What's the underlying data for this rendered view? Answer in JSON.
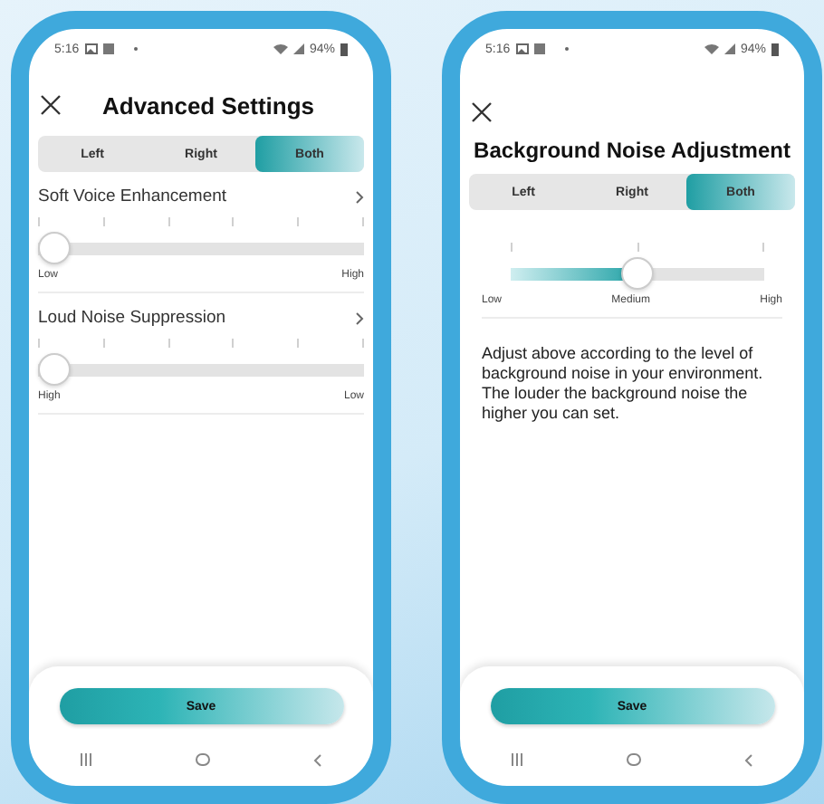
{
  "screens": [
    {
      "kind": "list",
      "status": {
        "time": "5:16",
        "battery": "94%"
      },
      "title": "Advanced Settings",
      "tabs": [
        {
          "label": "Left",
          "selected": false
        },
        {
          "label": "Right",
          "selected": false
        },
        {
          "label": "Both",
          "selected": true
        }
      ],
      "settings": [
        {
          "name": "Soft Voice Enhancement",
          "level": 0,
          "min_label": "Low",
          "max_label": "High"
        },
        {
          "name": "Loud Noise Suppression",
          "level": 0,
          "min_label": "High",
          "max_label": "Low"
        }
      ],
      "save_button": "Save"
    },
    {
      "kind": "single",
      "status": {
        "time": "5:16",
        "battery": "94%"
      },
      "title": "Background Noise Adjustment",
      "tabs": [
        {
          "label": "Left",
          "selected": false
        },
        {
          "label": "Right",
          "selected": false
        },
        {
          "label": "Both",
          "selected": true
        }
      ],
      "slider": {
        "level": 0.5,
        "labels": [
          "Low",
          "Medium",
          "High"
        ]
      },
      "description": "Adjust above according to the level of background noise in your environment. The louder the background noise the higher you can set.",
      "save_button": "Save"
    }
  ]
}
